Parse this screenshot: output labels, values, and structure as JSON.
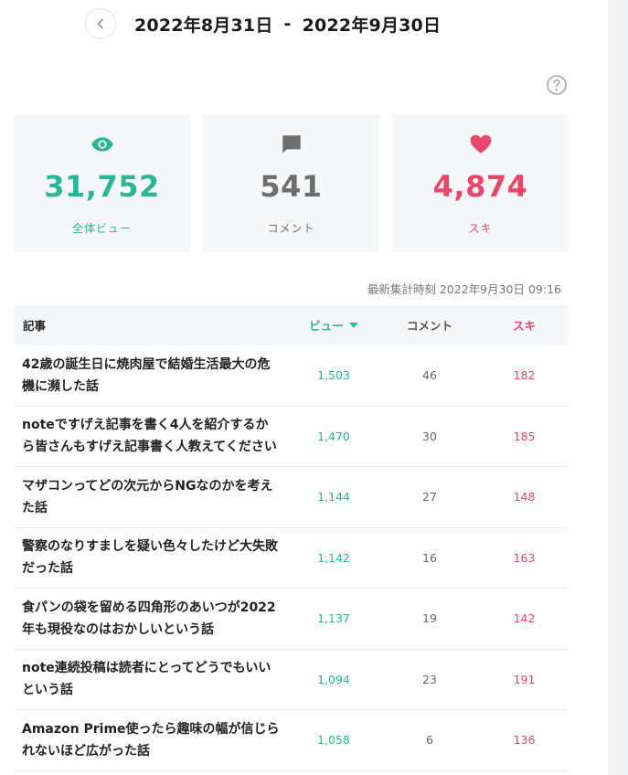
{
  "header": {
    "start_date": "2022年8月31日",
    "separator": "-",
    "end_date": "2022年9月30日"
  },
  "icons": {
    "back": "chevron-left-icon",
    "help": "question-circle-icon",
    "views": "eye-icon",
    "comments": "comment-icon",
    "likes": "heart-icon"
  },
  "colors": {
    "views": "#2cb696",
    "comments": "#6e6e6e",
    "likes": "#e8476a"
  },
  "summary": {
    "views": {
      "value": "31,752",
      "label": "全体ビュー"
    },
    "comments": {
      "value": "541",
      "label": "コメント"
    },
    "likes": {
      "value": "4,874",
      "label": "スキ"
    }
  },
  "updated_text": "最新集計時刻 2022年9月30日 09:16",
  "table": {
    "headers": {
      "title": "記事",
      "views": "ビュー",
      "comments": "コメント",
      "likes": "スキ"
    },
    "sort": {
      "column": "views",
      "direction": "descending"
    },
    "rows": [
      {
        "title": "42歳の誕生日に焼肉屋で結婚生活最大の危機に瀕した話",
        "views": "1,503",
        "comments": "46",
        "likes": "182"
      },
      {
        "title": "noteですげえ記事を書く4人を紹介するから皆さんもすげえ記事書く人教えてください",
        "views": "1,470",
        "comments": "30",
        "likes": "185"
      },
      {
        "title": "マザコンってどの次元からNGなのかを考えた話",
        "views": "1,144",
        "comments": "27",
        "likes": "148"
      },
      {
        "title": "警察のなりすましを疑い色々したけど大失敗だった話",
        "views": "1,142",
        "comments": "16",
        "likes": "163"
      },
      {
        "title": "食パンの袋を留める四角形のあいつが2022年も現役なのはおかしいという話",
        "views": "1,137",
        "comments": "19",
        "likes": "142"
      },
      {
        "title": "note連続投稿は読者にとってどうでもいいという話",
        "views": "1,094",
        "comments": "23",
        "likes": "191"
      },
      {
        "title": "Amazon Prime使ったら趣味の幅が信じられないほど広がった話",
        "views": "1,058",
        "comments": "6",
        "likes": "136"
      }
    ]
  }
}
